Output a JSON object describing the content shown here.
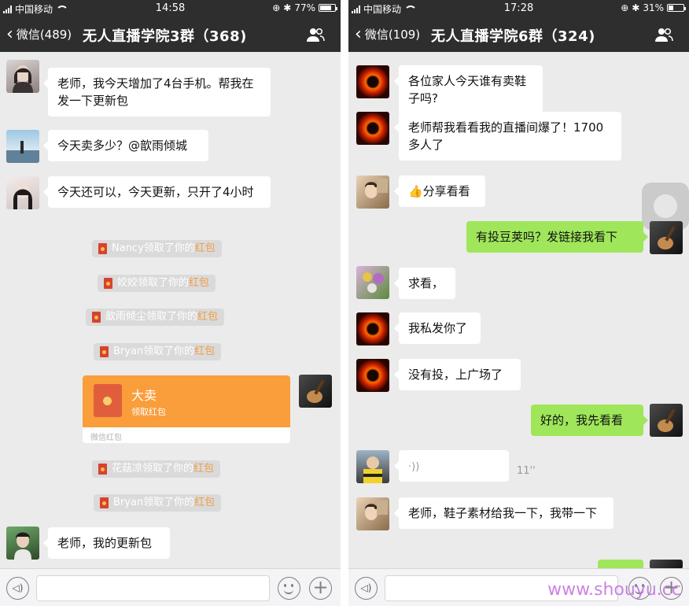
{
  "watermark": "www.shouyu.cc",
  "left_phone": {
    "status": {
      "carrier": "中国移动",
      "time": "14:58",
      "battery": "77%",
      "battery_level": 0.77
    },
    "nav": {
      "back": "微信(489)",
      "title": "无人直播学院3群（368)"
    },
    "messages": [
      {
        "text": "老师，我今天增加了4台手机。帮我在发一下更新包"
      },
      {
        "text": "今天卖多少？@歆雨倾城"
      },
      {
        "text": "今天还可以，今天更新，只开了4小时"
      },
      {
        "text": "老师，我的更新包"
      }
    ],
    "system": [
      {
        "name": "Nancy",
        "mid": "领取了你的",
        "hl": "红包"
      },
      {
        "name": "姣姣",
        "mid": "领取了你的",
        "hl": "红包"
      },
      {
        "name": "歆雨倾尘",
        "mid": "领取了你的",
        "hl": "红包"
      },
      {
        "name": "Bryan",
        "mid": "领取了你的",
        "hl": "红包"
      },
      {
        "name": "花菇凉",
        "mid": "领取了你的",
        "hl": "红包"
      },
      {
        "name": "Bryan",
        "mid": "领取了你的",
        "hl": "红包"
      }
    ],
    "red_packet": {
      "title": "大卖",
      "subtitle": "领取红包",
      "footer": "微信红包"
    }
  },
  "right_phone": {
    "status": {
      "carrier": "中国移动",
      "time": "17:28",
      "battery": "31%",
      "battery_level": 0.31
    },
    "nav": {
      "back": "微信(109)",
      "title": "无人直播学院6群（324)"
    },
    "messages": [
      {
        "text": "各位家人今天谁有卖鞋子吗?"
      },
      {
        "text": "老师帮我看看我的直播间爆了！1700多人了"
      },
      {
        "text": "👍分享看看"
      },
      {
        "text": "有投豆荚吗？发链接我看下"
      },
      {
        "text": "求看，"
      },
      {
        "text": "我私发你了"
      },
      {
        "text": "没有投，上广场了"
      },
      {
        "text": "好的，我先看看"
      },
      {
        "text": "老师，鞋子素材给我一下，我带一下"
      }
    ],
    "voice": {
      "duration": "11''"
    }
  }
}
